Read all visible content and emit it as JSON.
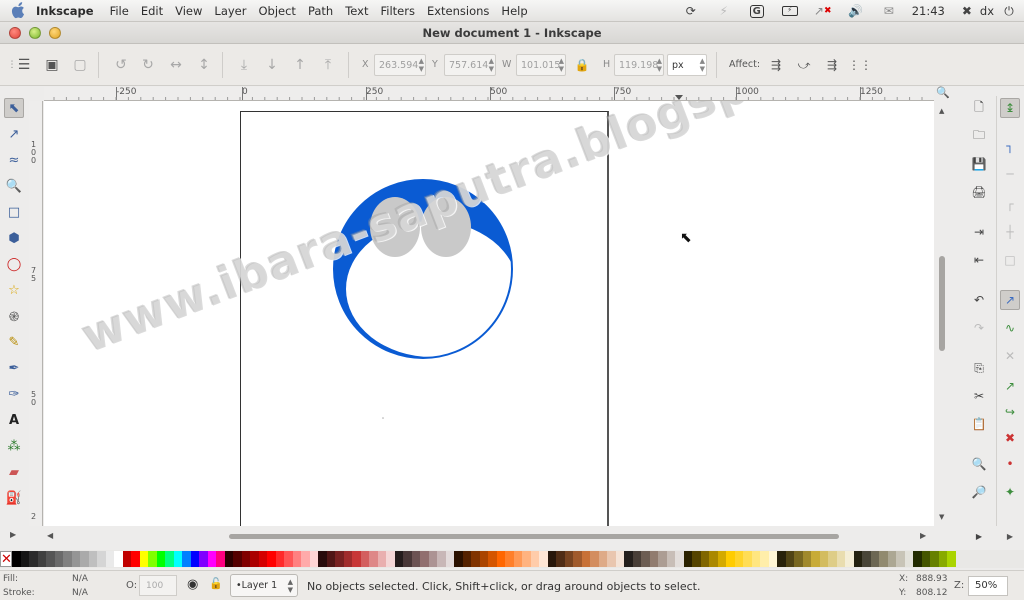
{
  "menubar": {
    "app_name": "Inkscape",
    "items": [
      {
        "label": "File"
      },
      {
        "label": "Edit"
      },
      {
        "label": "View"
      },
      {
        "label": "Layer"
      },
      {
        "label": "Object"
      },
      {
        "label": "Path"
      },
      {
        "label": "Text"
      },
      {
        "label": "Filters"
      },
      {
        "label": "Extensions"
      },
      {
        "label": "Help"
      }
    ],
    "tray": {
      "time": "21:43",
      "user": "dx",
      "icons": [
        "sync-icon",
        "power-icon",
        "g-icon",
        "battery-icon",
        "network-icon",
        "volume-icon",
        "mail-icon",
        "user-icon"
      ]
    }
  },
  "window": {
    "title": "New document 1 - Inkscape"
  },
  "toolbar": {
    "x_label": "X",
    "x_value": "263.594",
    "y_label": "Y",
    "y_value": "757.614",
    "w_label": "W",
    "w_value": "101.015",
    "h_label": "H",
    "h_value": "119.198",
    "unit": "px",
    "affect_label": "Affect:"
  },
  "ruler": {
    "labels": [
      "-250",
      "0",
      "250",
      "500",
      "750",
      "1000",
      "1250"
    ]
  },
  "vruler": {
    "labels": [
      "1\n0\n0",
      "7\n5",
      "5\n0",
      "2"
    ]
  },
  "canvas": {
    "watermark": "www.ibara-saputra.blogspot.com"
  },
  "colors": {
    "accent_blue": "#0a5bd3",
    "ellipse_grey": "#c9c9c9"
  },
  "status": {
    "fill_label": "Fill:",
    "fill_value": "N/A",
    "stroke_label": "Stroke:",
    "stroke_value": "N/A",
    "opacity_label": "O:",
    "opacity_value": "100",
    "layer": "•Layer 1",
    "message": "No objects selected. Click, Shift+click, or drag around objects to select.",
    "x_label": "X:",
    "x_value": "888.93",
    "y_label": "Y:",
    "y_value": "808.12",
    "z_label": "Z:",
    "zoom": "50%"
  }
}
